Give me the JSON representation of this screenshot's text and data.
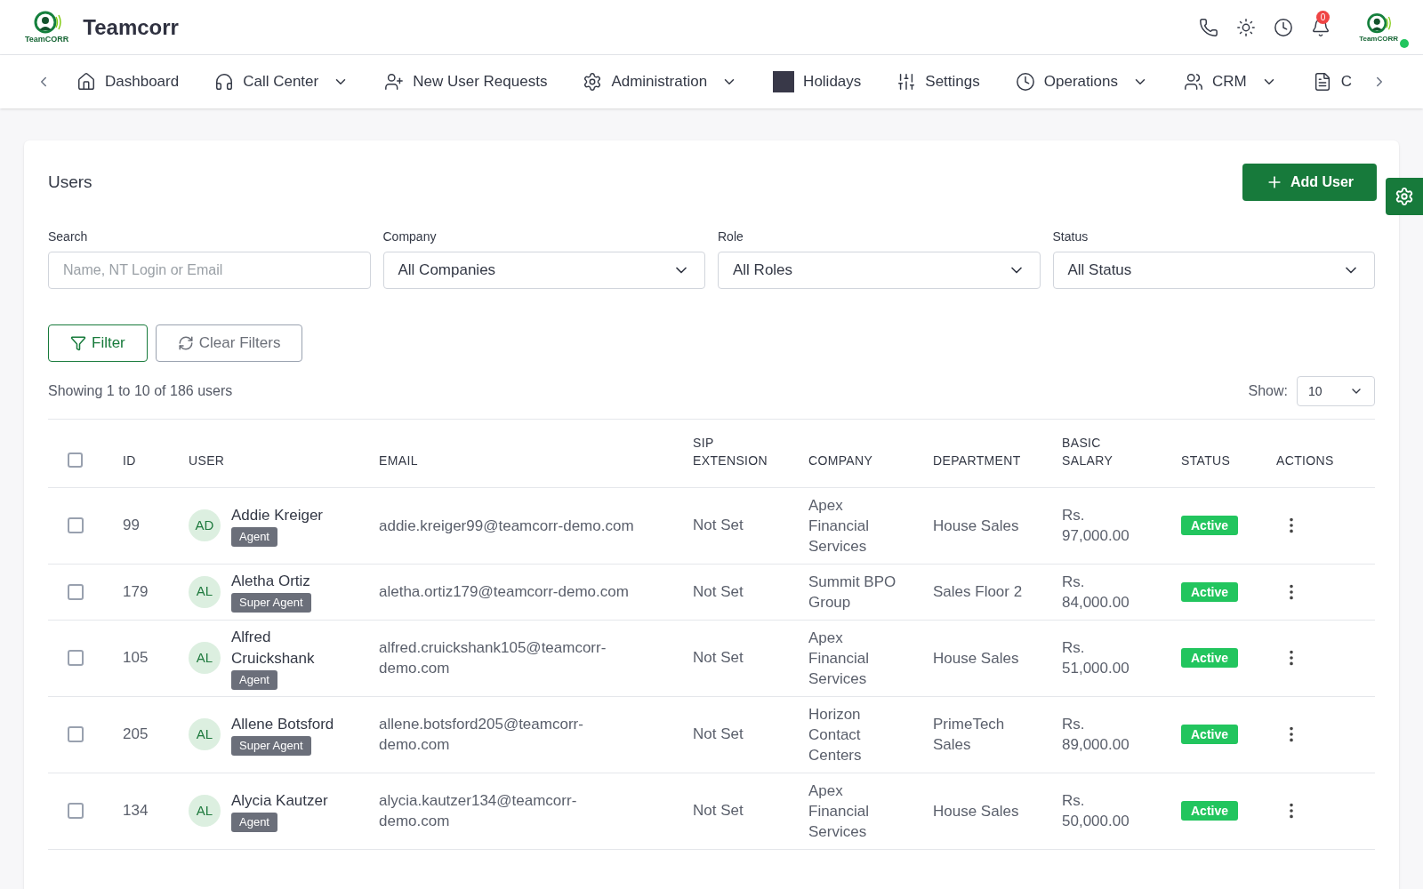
{
  "header": {
    "app_name": "Teamcorr",
    "logo_text": "TeamCORR",
    "notification_count": "0",
    "profile_logo_text": "TeamCORR",
    "online": true
  },
  "nav": [
    {
      "label": "Dashboard",
      "dropdown": false
    },
    {
      "label": "Call Center",
      "dropdown": true
    },
    {
      "label": "New User Requests",
      "dropdown": false
    },
    {
      "label": "Administration",
      "dropdown": true
    },
    {
      "label": "Holidays",
      "dropdown": false
    },
    {
      "label": "Settings",
      "dropdown": false
    },
    {
      "label": "Operations",
      "dropdown": true
    },
    {
      "label": "CRM",
      "dropdown": true
    },
    {
      "label": "C",
      "dropdown": false
    }
  ],
  "page": {
    "title": "Users",
    "add_button": "Add User"
  },
  "filters": [
    {
      "label": "Search",
      "kind": "text",
      "placeholder": "Name, NT Login or Email"
    },
    {
      "label": "Company",
      "kind": "select",
      "value": "All Companies"
    },
    {
      "label": "Role",
      "kind": "select",
      "value": "All Roles"
    },
    {
      "label": "Status",
      "kind": "select",
      "value": "All Status"
    }
  ],
  "filter_button": "Filter",
  "clear_button": "Clear Filters",
  "summary": "Showing 1 to 10 of 186 users",
  "show_label": "Show:",
  "page_size": "10",
  "table": {
    "select_all_checked": false,
    "columns": [
      "ID",
      "USER",
      "EMAIL",
      "SIP EXTENSION",
      "COMPANY",
      "DEPARTMENT",
      "BASIC SALARY",
      "STATUS",
      "ACTIONS"
    ],
    "rows": [
      {
        "checked": false,
        "id": "99",
        "initials": "AD",
        "name": "Addie Kreiger",
        "role": "Agent",
        "email": "addie.kreiger99@teamcorr-demo.com",
        "sip": "Not Set",
        "company": "Apex Financial Services",
        "department": "House Sales",
        "salary": "Rs. 97,000.00",
        "status": "Active"
      },
      {
        "checked": false,
        "id": "179",
        "initials": "AL",
        "name": "Aletha Ortiz",
        "role": "Super Agent",
        "email": "aletha.ortiz179@teamcorr-demo.com",
        "sip": "Not Set",
        "company": "Summit BPO Group",
        "department": "Sales Floor 2",
        "salary": "Rs. 84,000.00",
        "status": "Active"
      },
      {
        "checked": false,
        "id": "105",
        "initials": "AL",
        "name": "Alfred Cruickshank",
        "role": "Agent",
        "email": "alfred.cruickshank105@teamcorr-demo.com",
        "sip": "Not Set",
        "company": "Apex Financial Services",
        "department": "House Sales",
        "salary": "Rs. 51,000.00",
        "status": "Active"
      },
      {
        "checked": false,
        "id": "205",
        "initials": "AL",
        "name": "Allene Botsford",
        "role": "Super Agent",
        "email": "allene.botsford205@teamcorr-demo.com",
        "sip": "Not Set",
        "company": "Horizon Contact Centers",
        "department": "PrimeTech Sales",
        "salary": "Rs. 89,000.00",
        "status": "Active"
      },
      {
        "checked": false,
        "id": "134",
        "initials": "AL",
        "name": "Alycia Kautzer",
        "role": "Agent",
        "email": "alycia.kautzer134@teamcorr-demo.com",
        "sip": "Not Set",
        "company": "Apex Financial Services",
        "department": "House Sales",
        "salary": "Rs. 50,000.00",
        "status": "Active"
      }
    ]
  }
}
